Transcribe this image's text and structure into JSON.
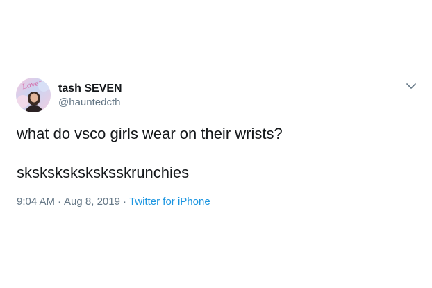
{
  "tweet": {
    "avatar_logo_text": "Lover",
    "display_name": "tash SEVEN",
    "handle": "@hauntedcth",
    "text_line_1": "what do vsco girls wear on their wrists?",
    "text_line_2": "sksksksksksksskrunchies",
    "time": "9:04 AM",
    "separator": "·",
    "date": "Aug 8, 2019",
    "source": "Twitter for iPhone"
  },
  "icons": {
    "more": "chevron-down-icon"
  },
  "colors": {
    "name": "#14171a",
    "secondary": "#657786",
    "link": "#1b95e0",
    "background": "#ffffff"
  }
}
